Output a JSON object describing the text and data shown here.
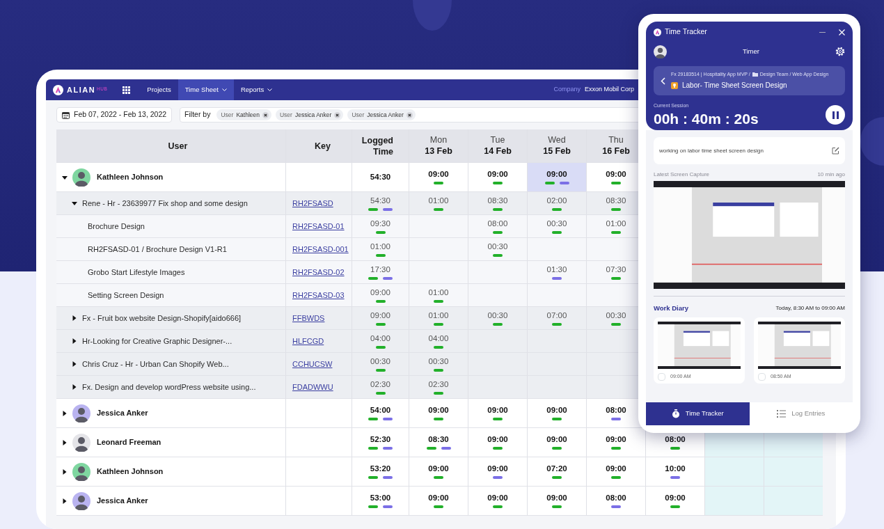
{
  "nav": {
    "logo": {
      "name": "ALIAN",
      "suffix": "HUB"
    },
    "items": [
      {
        "label": "Projects",
        "selected": false,
        "dropdown": false
      },
      {
        "label": "Time Sheet",
        "selected": true,
        "dropdown": true
      },
      {
        "label": "Reports",
        "selected": false,
        "dropdown": true
      }
    ],
    "company_label": "Company",
    "company": "Exxon Mobil Corp"
  },
  "filters": {
    "date_range": "Feb 07, 2022 - Feb 13, 2022",
    "label": "Filter by",
    "chips": [
      {
        "field": "User",
        "value": "Kathleen"
      },
      {
        "field": "User",
        "value": "Jessica Anker"
      },
      {
        "field": "User",
        "value": "Jessica Anker"
      }
    ]
  },
  "table": {
    "columns": [
      "User",
      "Key",
      "Logged Time"
    ],
    "days": [
      {
        "weekday": "Mon",
        "date": "13 Feb"
      },
      {
        "weekday": "Tue",
        "date": "14 Feb"
      },
      {
        "weekday": "Wed",
        "date": "15 Feb"
      },
      {
        "weekday": "Thu",
        "date": "16 Feb"
      }
    ],
    "rows": [
      {
        "kind": "user",
        "name": "Kathleen Johnson",
        "avatar": {
          "color": "#7fd6a0"
        },
        "expanded": true,
        "logged": {
          "time": "54:30"
        },
        "days": [
          {
            "time": "09:00",
            "bars": [
              {
                "color": "#22b02a"
              }
            ],
            "selected": false
          },
          {
            "time": "09:00",
            "bars": [
              {
                "color": "#22b02a"
              }
            ],
            "selected": false
          },
          {
            "time": "09:00",
            "bars": [
              {
                "color": "#22b02a"
              },
              {
                "color": "#7b6fe6"
              }
            ],
            "selected": true
          },
          {
            "time": "09:00",
            "bars": [
              {
                "color": "#22b02a"
              }
            ],
            "selected": false
          }
        ],
        "children": [
          {
            "kind": "task",
            "title": "Rene - Hr - 23639977 Fix shop and some design",
            "key": "RH2FSASD",
            "expanded": true,
            "logged": {
              "time": "54:30",
              "bars": [
                {
                  "color": "#22b02a"
                },
                {
                  "color": "#7b6fe6"
                }
              ]
            },
            "days": [
              {
                "time": "01:00",
                "bars": [
                  {
                    "color": "#22b02a"
                  }
                ],
                "selected": false
              },
              {
                "time": "08:30",
                "bars": [
                  {
                    "color": "#22b02a"
                  }
                ],
                "selected": false
              },
              {
                "time": "02:00",
                "bars": [
                  {
                    "color": "#22b02a"
                  }
                ],
                "selected": false
              },
              {
                "time": "08:30",
                "bars": [
                  {
                    "color": "#22b02a"
                  }
                ],
                "selected": false
              }
            ],
            "children": [
              {
                "kind": "subtask",
                "title": "Brochure Design",
                "key": "RH2FSASD-01",
                "logged": {
                  "time": "09:30",
                  "bars": [
                    {
                      "color": "#22b02a"
                    }
                  ]
                },
                "days": [
                  {
                    "selected": false
                  },
                  {
                    "time": "08:00",
                    "bars": [
                      {
                        "color": "#22b02a"
                      }
                    ],
                    "selected": false
                  },
                  {
                    "time": "00:30",
                    "bars": [
                      {
                        "color": "#22b02a"
                      }
                    ],
                    "selected": false
                  },
                  {
                    "time": "01:00",
                    "bars": [
                      {
                        "color": "#22b02a"
                      }
                    ],
                    "selected": false
                  }
                ]
              },
              {
                "kind": "subtask",
                "title": "RH2FSASD-01 / Brochure Design V1-R1",
                "key": "RH2FSASD-001",
                "logged": {
                  "time": "01:00",
                  "bars": [
                    {
                      "color": "#22b02a"
                    }
                  ]
                },
                "days": [
                  {
                    "selected": false
                  },
                  {
                    "time": "00:30",
                    "bars": [
                      {
                        "color": "#22b02a"
                      }
                    ],
                    "selected": false
                  },
                  {
                    "selected": false
                  },
                  {
                    "selected": false
                  }
                ]
              },
              {
                "kind": "subtask",
                "title": "Grobo Start Lifestyle Images",
                "key": "RH2FSASD-02",
                "logged": {
                  "time": "17:30",
                  "bars": [
                    {
                      "color": "#22b02a"
                    },
                    {
                      "color": "#7b6fe6"
                    }
                  ]
                },
                "days": [
                  {
                    "selected": false
                  },
                  {
                    "selected": false
                  },
                  {
                    "time": "01:30",
                    "bars": [
                      {
                        "color": "#7b6fe6"
                      }
                    ],
                    "selected": false
                  },
                  {
                    "time": "07:30",
                    "bars": [
                      {
                        "color": "#22b02a"
                      }
                    ],
                    "selected": false
                  }
                ]
              },
              {
                "kind": "subtask",
                "title": "Setting Screen Design",
                "key": "RH2FSASD-03",
                "logged": {
                  "time": "09:00",
                  "bars": [
                    {
                      "color": "#22b02a"
                    }
                  ]
                },
                "days": [
                  {
                    "time": "01:00",
                    "bars": [
                      {
                        "color": "#22b02a"
                      }
                    ],
                    "selected": false
                  },
                  {
                    "selected": false
                  },
                  {
                    "selected": false
                  },
                  {
                    "selected": false
                  }
                ]
              }
            ]
          },
          {
            "kind": "task",
            "title": "Fx - Fruit box website Design-Shopify[aido666]",
            "key": "FFBWDS",
            "expanded": false,
            "logged": {
              "time": "09:00",
              "bars": [
                {
                  "color": "#22b02a"
                }
              ]
            },
            "days": [
              {
                "time": "01:00",
                "bars": [
                  {
                    "color": "#22b02a"
                  }
                ],
                "selected": false
              },
              {
                "time": "00:30",
                "bars": [
                  {
                    "color": "#22b02a"
                  }
                ],
                "selected": false
              },
              {
                "time": "07:00",
                "bars": [
                  {
                    "color": "#22b02a"
                  }
                ],
                "selected": false
              },
              {
                "time": "00:30",
                "bars": [
                  {
                    "color": "#22b02a"
                  }
                ],
                "selected": false
              }
            ]
          },
          {
            "kind": "task",
            "title": "Hr-Looking for Creative Graphic Designer-...",
            "key": "HLFCGD",
            "expanded": false,
            "logged": {
              "time": "04:00",
              "bars": [
                {
                  "color": "#22b02a"
                }
              ]
            },
            "days": [
              {
                "time": "04:00",
                "bars": [
                  {
                    "color": "#22b02a"
                  }
                ],
                "selected": false
              },
              {
                "selected": false
              },
              {
                "selected": false
              },
              {
                "selected": false
              }
            ]
          },
          {
            "kind": "task",
            "title": "Chris Cruz - Hr - Urban Can Shopify Web...",
            "key": "CCHUCSW",
            "expanded": false,
            "logged": {
              "time": "00:30",
              "bars": [
                {
                  "color": "#22b02a"
                }
              ]
            },
            "days": [
              {
                "time": "00:30",
                "bars": [
                  {
                    "color": "#22b02a"
                  }
                ],
                "selected": false
              },
              {
                "selected": false
              },
              {
                "selected": false
              },
              {
                "selected": false
              }
            ]
          },
          {
            "kind": "task",
            "title": "Fx. Design and develop wordPress website using...",
            "key": "FDADWWU",
            "expanded": false,
            "logged": {
              "time": "02:30",
              "bars": [
                {
                  "color": "#22b02a"
                }
              ]
            },
            "days": [
              {
                "time": "02:30",
                "bars": [
                  {
                    "color": "#22b02a"
                  }
                ],
                "selected": false
              },
              {
                "selected": false
              },
              {
                "selected": false
              },
              {
                "selected": false
              }
            ]
          }
        ]
      },
      {
        "kind": "user",
        "name": "Jessica Anker",
        "avatar": {
          "color": "#b9b3f0"
        },
        "expanded": false,
        "logged": {
          "time": "54:00",
          "bars": [
            {
              "color": "#22b02a"
            },
            {
              "color": "#7b6fe6"
            }
          ]
        },
        "days": [
          {
            "time": "09:00",
            "bars": [
              {
                "color": "#22b02a"
              }
            ],
            "selected": false
          },
          {
            "time": "09:00",
            "bars": [
              {
                "color": "#22b02a"
              }
            ],
            "selected": false
          },
          {
            "time": "09:00",
            "bars": [
              {
                "color": "#22b02a"
              }
            ],
            "selected": false
          },
          {
            "time": "08:00",
            "bars": [
              {
                "color": "#7b6fe6"
              }
            ],
            "selected": false
          }
        ]
      },
      {
        "kind": "user",
        "name": "Leonard Freeman",
        "avatar": {
          "color": "#e4e4e8"
        },
        "expanded": false,
        "logged": {
          "time": "52:30",
          "bars": [
            {
              "color": "#22b02a"
            },
            {
              "color": "#7b6fe6"
            }
          ]
        },
        "days": [
          {
            "time": "08:30",
            "bars": [
              {
                "color": "#22b02a"
              },
              {
                "color": "#7b6fe6"
              }
            ],
            "selected": false
          },
          {
            "time": "09:00",
            "bars": [
              {
                "color": "#22b02a"
              }
            ],
            "selected": false
          },
          {
            "time": "09:00",
            "bars": [
              {
                "color": "#22b02a"
              }
            ],
            "selected": false
          },
          {
            "time": "09:00",
            "bars": [
              {
                "color": "#22b02a"
              }
            ],
            "selected": false
          },
          {
            "time": "08:00",
            "bars": [
              {
                "color": "#22b02a"
              }
            ],
            "selected": false
          }
        ]
      },
      {
        "kind": "user",
        "name": "Kathleen Johnson",
        "avatar": {
          "color": "#7fd6a0"
        },
        "expanded": false,
        "logged": {
          "time": "53:20",
          "bars": [
            {
              "color": "#22b02a"
            },
            {
              "color": "#7b6fe6"
            }
          ]
        },
        "days": [
          {
            "time": "09:00",
            "bars": [
              {
                "color": "#22b02a"
              }
            ],
            "selected": false
          },
          {
            "time": "09:00",
            "bars": [
              {
                "color": "#7b6fe6"
              }
            ],
            "selected": false
          },
          {
            "time": "07:20",
            "bars": [
              {
                "color": "#22b02a"
              }
            ],
            "selected": false
          },
          {
            "time": "09:00",
            "bars": [
              {
                "color": "#22b02a"
              }
            ],
            "selected": false
          },
          {
            "time": "10:00",
            "bars": [
              {
                "color": "#7b6fe6"
              }
            ],
            "selected": false
          }
        ]
      },
      {
        "kind": "user",
        "name": "Jessica Anker",
        "avatar": {
          "color": "#b9b3f0"
        },
        "expanded": false,
        "logged": {
          "time": "53:00",
          "bars": [
            {
              "color": "#22b02a"
            },
            {
              "color": "#7b6fe6"
            }
          ]
        },
        "days": [
          {
            "time": "09:00",
            "bars": [
              {
                "color": "#22b02a"
              }
            ],
            "selected": false
          },
          {
            "time": "09:00",
            "bars": [
              {
                "color": "#22b02a"
              }
            ],
            "selected": false
          },
          {
            "time": "09:00",
            "bars": [
              {
                "color": "#22b02a"
              }
            ],
            "selected": false
          },
          {
            "time": "08:00",
            "bars": [
              {
                "color": "#7b6fe6"
              }
            ],
            "selected": false
          },
          {
            "time": "09:00",
            "bars": [
              {
                "color": "#22b02a"
              }
            ],
            "selected": false
          }
        ]
      }
    ]
  },
  "tracker": {
    "title": "Time Tracker",
    "heading": "Timer",
    "task": {
      "path": [
        "Fx 29183514 | Hospitality App MVP /",
        "Design Team / Web App Design"
      ],
      "title": "Labor- Time Sheet Screen Design"
    },
    "session_label": "Current Session",
    "session_time": "00h : 40m : 20s",
    "note": "working on labor time sheet screen design",
    "capture_label": "Latest Screen Capture",
    "capture_time": "10 min ago",
    "diary": {
      "title": "Work Diary",
      "range": "Today, 8:30 AM to 09:00 AM",
      "shots": [
        {
          "time": "09:00 AM",
          "checked": false
        },
        {
          "time": "08:50 AM",
          "checked": false
        }
      ]
    },
    "tabs": [
      {
        "kind": "stopwatch",
        "label": "Time Tracker",
        "selected": true
      },
      {
        "kind": "list",
        "label": "Log Entries",
        "selected": false
      }
    ]
  }
}
